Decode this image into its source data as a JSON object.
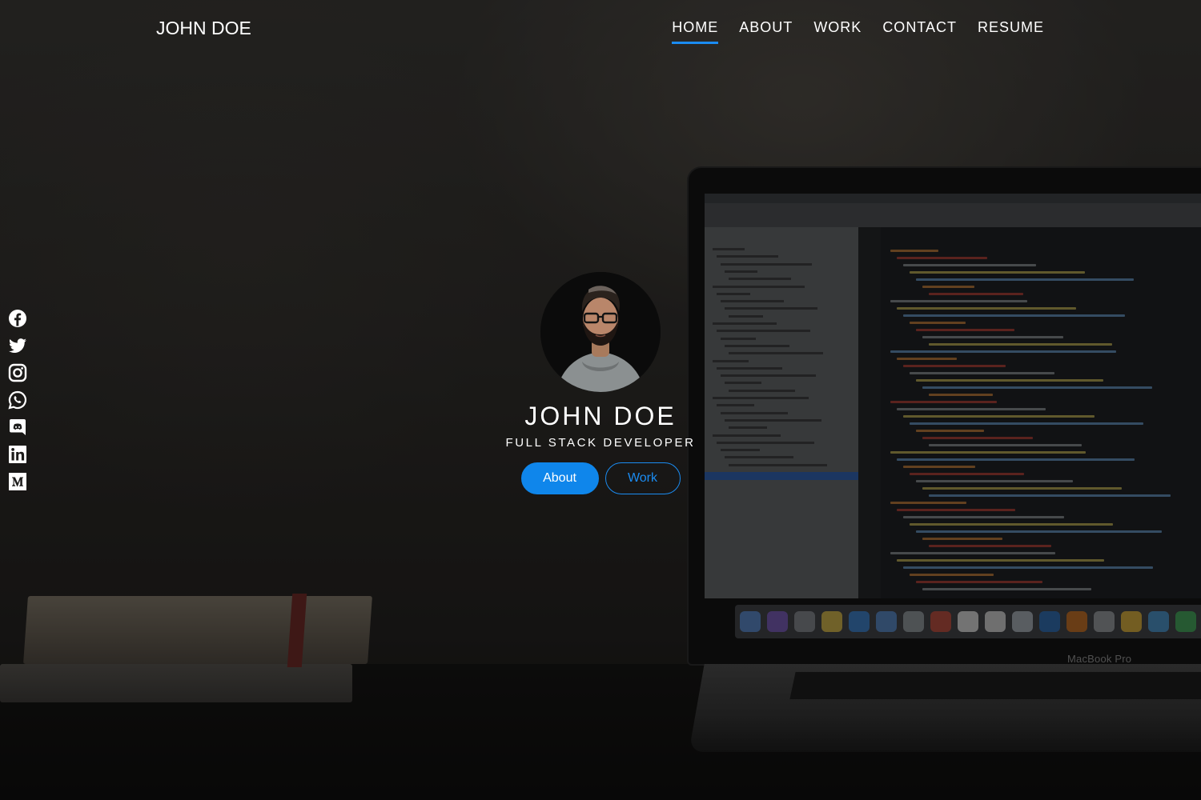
{
  "brand": {
    "name": "JOHN DOE"
  },
  "nav": {
    "items": [
      {
        "label": "HOME",
        "active": true
      },
      {
        "label": "ABOUT",
        "active": false
      },
      {
        "label": "WORK",
        "active": false
      },
      {
        "label": "CONTACT",
        "active": false
      },
      {
        "label": "RESUME",
        "active": false
      }
    ]
  },
  "social": {
    "icons": [
      "facebook-icon",
      "twitter-icon",
      "instagram-icon",
      "whatsapp-icon",
      "discord-icon",
      "linkedin-icon",
      "medium-icon"
    ]
  },
  "profile": {
    "name": "JOHN DOE",
    "role": "FULL STACK DEVELOPER",
    "primary_button": "About",
    "secondary_button": "Work"
  },
  "background": {
    "laptop_label": "MacBook Pro"
  },
  "colors": {
    "accent": "#1b8cf2",
    "primary_button_bg": "#0f86eb",
    "text": "#ffffff"
  }
}
